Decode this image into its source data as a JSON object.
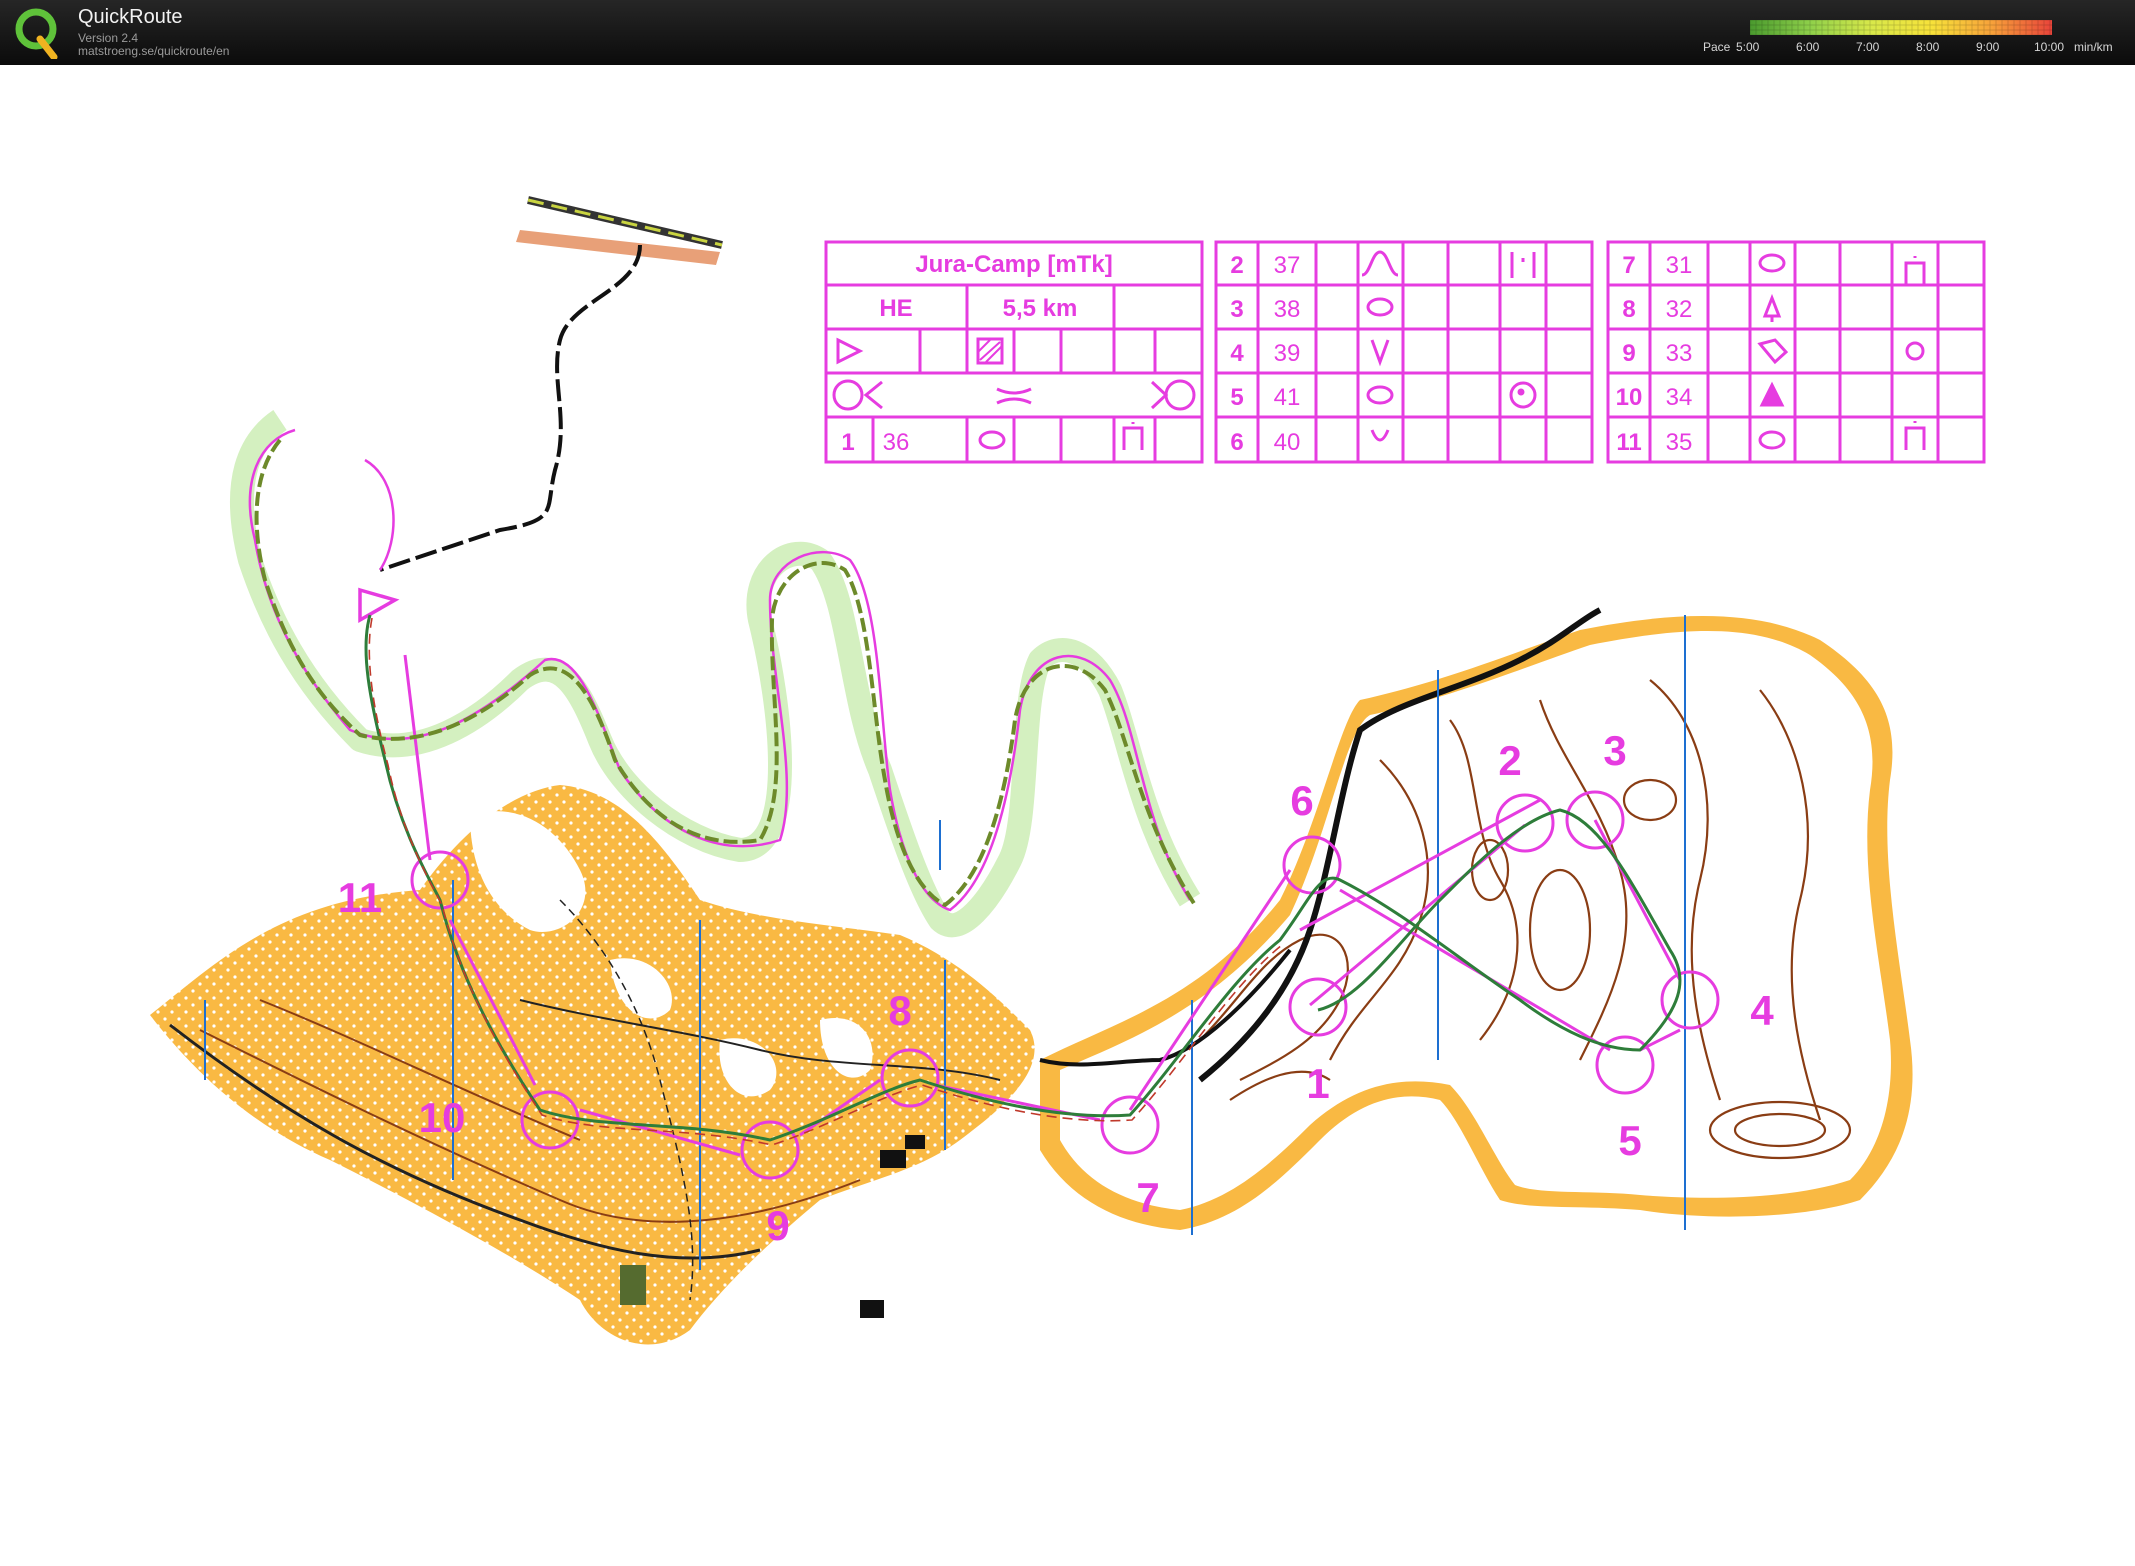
{
  "app": {
    "title": "QuickRoute",
    "version": "Version 2.4",
    "url": "matstroeng.se/quickroute/en"
  },
  "pace_legend": {
    "label": "Pace",
    "ticks": [
      "5:00",
      "6:00",
      "7:00",
      "8:00",
      "9:00",
      "10:00"
    ],
    "unit": "min/km",
    "gradient_colors": [
      "#4a9a2e",
      "#8fd04a",
      "#d8e84a",
      "#f7e23a",
      "#f7a23a",
      "#e8443a"
    ]
  },
  "colors": {
    "course": "#e63ce0",
    "terrain_yellow": "#f9b943",
    "contour_brown": "#8a3d14",
    "route_green": "#2e7d3a",
    "route_red": "#c0392b",
    "grid_blue": "#1d6fd1",
    "road_black": "#111111"
  },
  "control_description": {
    "event": "Jura-Camp  [mTk]",
    "class": "HE",
    "length": "5,5 km",
    "controls": [
      {
        "num": "1",
        "code": "36"
      },
      {
        "num": "2",
        "code": "37"
      },
      {
        "num": "3",
        "code": "38"
      },
      {
        "num": "4",
        "code": "39"
      },
      {
        "num": "5",
        "code": "41"
      },
      {
        "num": "6",
        "code": "40"
      },
      {
        "num": "7",
        "code": "31"
      },
      {
        "num": "8",
        "code": "32"
      },
      {
        "num": "9",
        "code": "33"
      },
      {
        "num": "10",
        "code": "34"
      },
      {
        "num": "11",
        "code": "35"
      }
    ]
  },
  "map_labels": [
    "1",
    "2",
    "3",
    "4",
    "5",
    "6",
    "7",
    "8",
    "9",
    "10",
    "11"
  ]
}
